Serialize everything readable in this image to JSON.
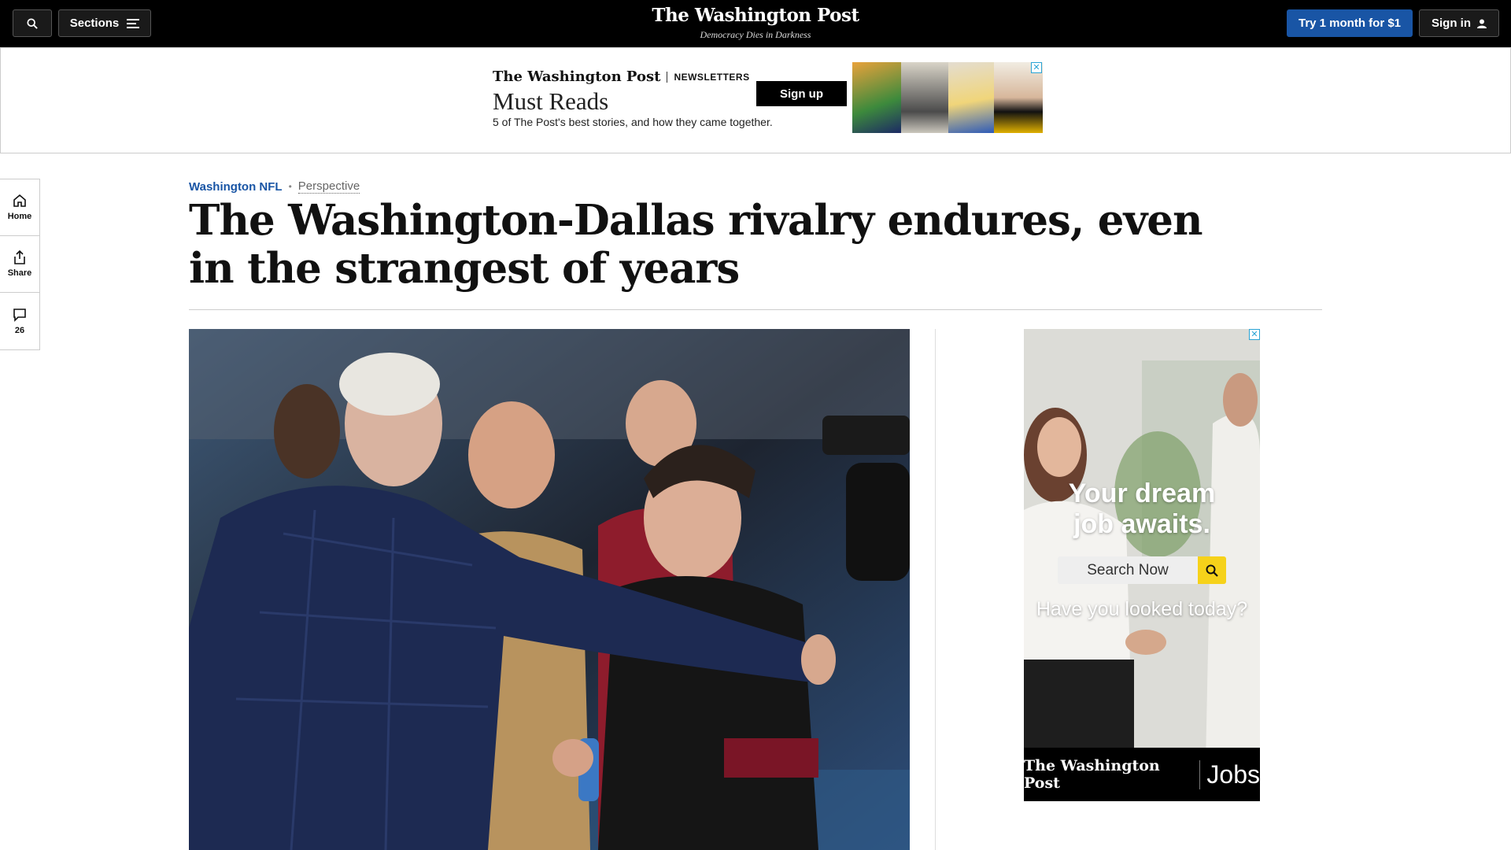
{
  "header": {
    "sections_label": "Sections",
    "logo": "The Washington Post",
    "tagline": "Democracy Dies in Darkness",
    "subscribe_label": "Try 1 month for $1",
    "signin_label": "Sign in"
  },
  "newsletter_ad": {
    "logo": "The Washington Post",
    "badge": "NEWSLETTERS",
    "title": "Must Reads",
    "subtitle": "5 of The Post's best stories, and how they came together.",
    "signup_label": "Sign up"
  },
  "left_rail": {
    "home_label": "Home",
    "share_label": "Share",
    "comments_count": "26"
  },
  "article": {
    "section": "Washington NFL",
    "label": "Perspective",
    "headline": "The Washington-Dallas rivalry endures, even in the strangest of years"
  },
  "side_ad": {
    "headline_line1": "Your dream",
    "headline_line2": "job awaits.",
    "search_label": "Search Now",
    "question": "Have you looked today?",
    "footer_logo": "The Washington Post",
    "footer_product": "Jobs"
  },
  "colors": {
    "accent_blue": "#1955a5",
    "search_yellow": "#f6d21a",
    "topbar": "#000000"
  }
}
